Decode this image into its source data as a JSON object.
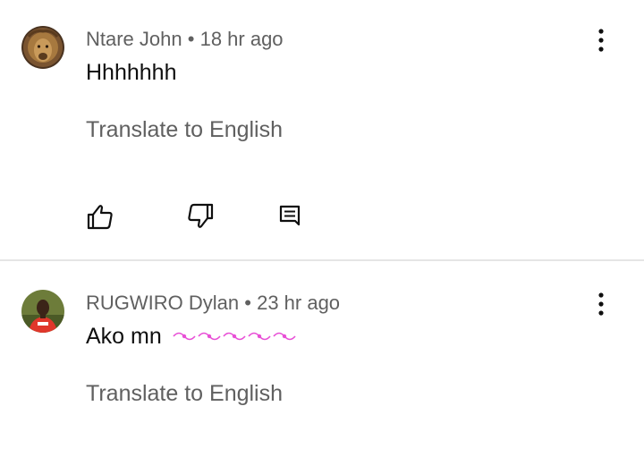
{
  "comments": [
    {
      "author": "Ntare John",
      "separator": "•",
      "time": "18 hr ago",
      "text": "Hhhhhhh",
      "translate_label": "Translate to English",
      "avatar_icon": "lion-avatar",
      "actions": [
        "like-icon",
        "dislike-icon",
        "reply-icon"
      ]
    },
    {
      "author": "RUGWIRO Dylan",
      "separator": "•",
      "time": "23 hr ago",
      "text": "Ako mn",
      "emoji_icon": "heart-ribbon-emoji",
      "translate_label": "Translate to English",
      "avatar_icon": "person-avatar"
    }
  ],
  "colors": {
    "meta": "#606060",
    "text": "#0f0f0f",
    "divider": "#e5e5e5",
    "emoji": "#e84fd6"
  }
}
